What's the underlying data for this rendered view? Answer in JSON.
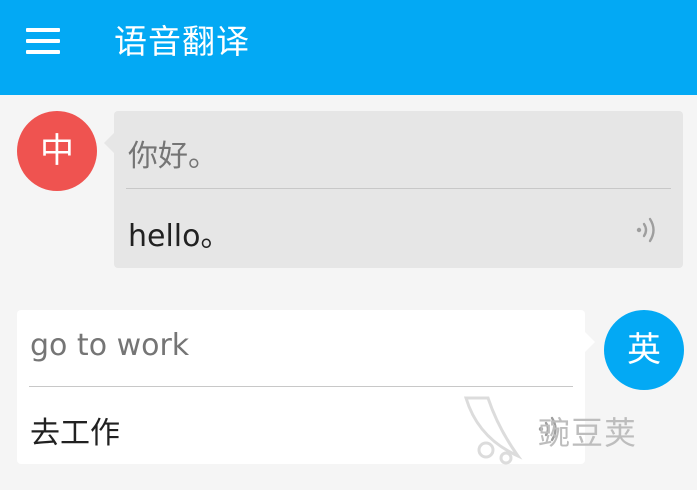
{
  "app_bar": {
    "title": "语音翻译",
    "menu_icon": "hamburger-menu-icon",
    "background_color": "#03a9f4"
  },
  "messages": [
    {
      "speaker_badge": "中",
      "badge_color": "#ef5350",
      "source_text": "你好。",
      "translated_text": "hello。",
      "play_icon": "speaker-wave-icon"
    },
    {
      "speaker_badge": "英",
      "badge_color": "#03a9f4",
      "source_text": "go to work",
      "translated_text": "去工作",
      "play_icon": "speaker-wave-icon"
    }
  ],
  "watermark": {
    "text": "豌豆荚",
    "icon": "pea-pod-logo-icon"
  }
}
